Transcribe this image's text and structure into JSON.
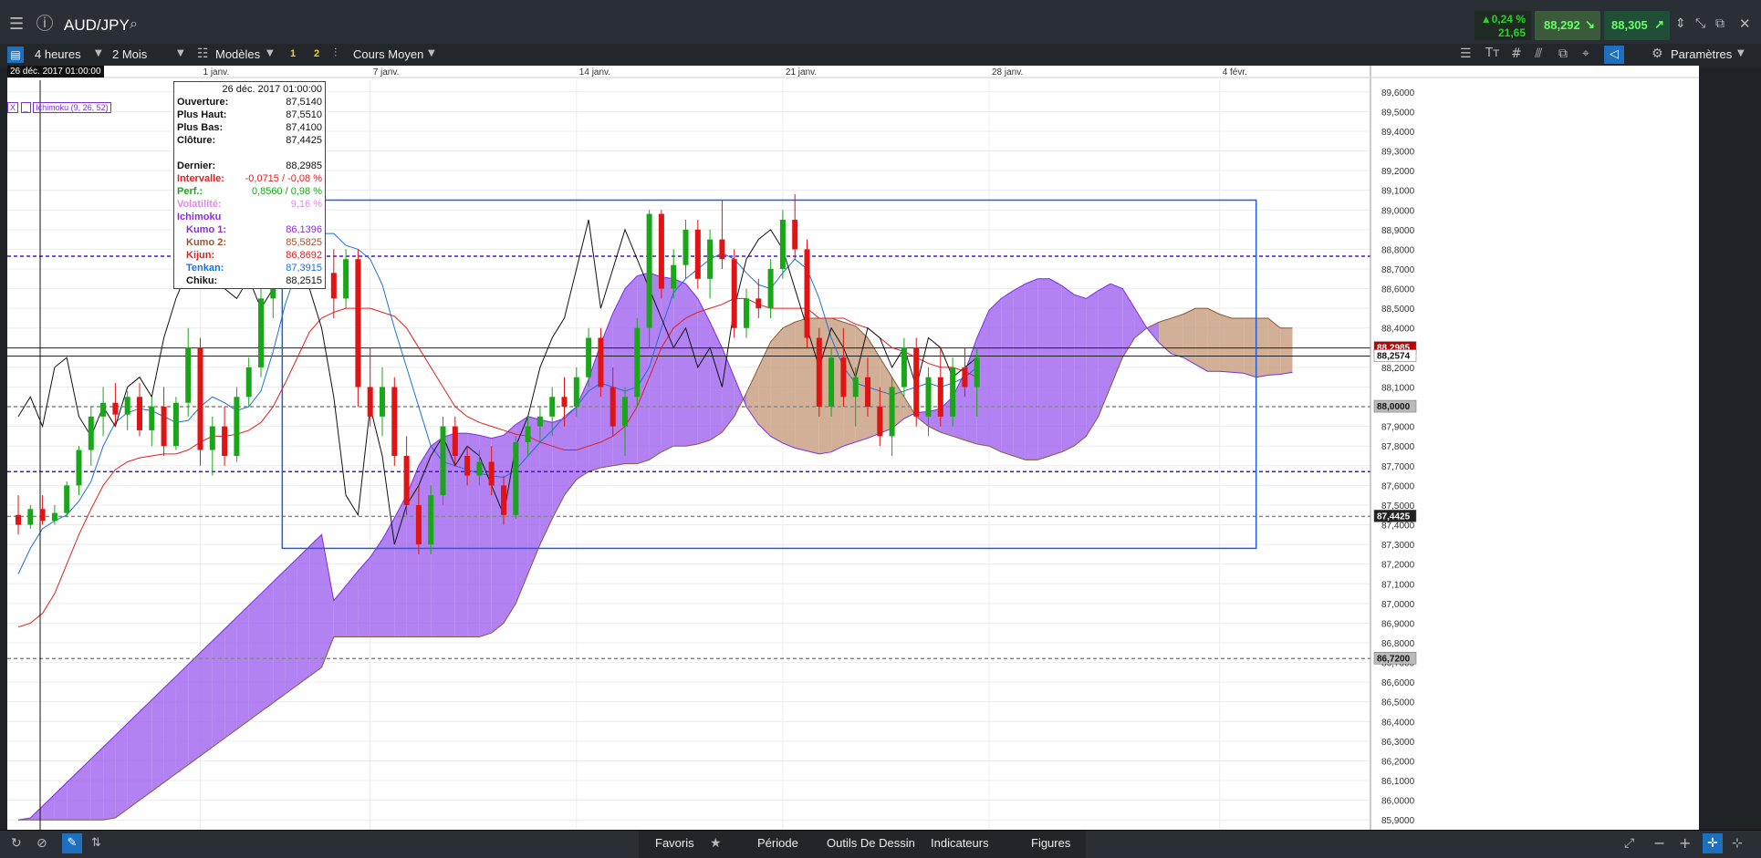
{
  "toolbar": {
    "symbol": "AUD/JPY",
    "change_pct": "▲0,24 %",
    "change_abs": "21,65",
    "bid": "88,292",
    "ask": "88,305",
    "interval": "4 heures",
    "range": "2 Mois",
    "templates": "Modèles",
    "tag1": "1",
    "tag2": "2",
    "price_type": "Cours Moyen",
    "settings": "Paramètres"
  },
  "cursor": {
    "date_label": "26 déc. 2017 01:00:00"
  },
  "indicator_tag": "Ichimoku (9, 26, 52)",
  "infobox": {
    "title": "26 déc. 2017 01:00:00",
    "rows": [
      {
        "k": "Ouverture:",
        "v": "87,5140",
        "color": "#111111"
      },
      {
        "k": "Plus Haut:",
        "v": "87,5510",
        "color": "#111111"
      },
      {
        "k": "Plus Bas:",
        "v": "87,4100",
        "color": "#111111"
      },
      {
        "k": "Clôture:",
        "v": "87,4425",
        "color": "#111111"
      },
      {
        "k": "",
        "v": "",
        "color": "#111111"
      },
      {
        "k": "Dernier:",
        "v": "88,2985",
        "color": "#111111"
      },
      {
        "k": "Intervalle:",
        "v": "-0,0715 / -0,08 %",
        "color": "#e02020"
      },
      {
        "k": "Perf.:",
        "v": "0,8560 / 0,98 %",
        "color": "#19a619"
      },
      {
        "k": "Volatilité:",
        "v": "9,16 %",
        "color": "#e08ae8"
      },
      {
        "k": "Ichimoku",
        "v": "",
        "color": "#8a2be2"
      },
      {
        "k": "  Kumo 1:",
        "v": "86,1396",
        "color": "#8a2be2"
      },
      {
        "k": "  Kumo 2:",
        "v": "85,5825",
        "color": "#a0522d"
      },
      {
        "k": "  Kijun:",
        "v": "86,8692",
        "color": "#e02020"
      },
      {
        "k": "  Tenkan:",
        "v": "87,3915",
        "color": "#1e6fd9"
      },
      {
        "k": "  Chiku:",
        "v": "88,2515",
        "color": "#111111"
      }
    ]
  },
  "bottom": {
    "favoris": "Favoris",
    "periode": "Période",
    "outils": "Outils De Dessin",
    "indicateurs": "Indicateurs",
    "figures": "Figures"
  },
  "colors": {
    "up": "#19a619",
    "down": "#e01414",
    "kumo_bull": "#a56bf0",
    "kumo_bear": "#c9a285",
    "tenkan": "#1e6fd9",
    "kijun": "#e02020",
    "chikou": "#111111"
  },
  "chart_data": {
    "type": "candlestick",
    "title": "AUD/JPY",
    "ylim": [
      85.85,
      89.65
    ],
    "y_ticks": [
      "89,6000",
      "89,5000",
      "89,4000",
      "89,3000",
      "89,2000",
      "89,1000",
      "89,0000",
      "88,9000",
      "88,8000",
      "88,7000",
      "88,6000",
      "88,5000",
      "88,4000",
      "88,3000",
      "88,2000",
      "88,1000",
      "88,0000",
      "87,9000",
      "87,8000",
      "87,7000",
      "87,6000",
      "87,5000",
      "87,4000",
      "87,3000",
      "87,2000",
      "87,1000",
      "87,0000",
      "86,9000",
      "86,8000",
      "86,7000",
      "86,6000",
      "86,5000",
      "86,4000",
      "86,3000",
      "86,2000",
      "86,1000",
      "86,0000",
      "85,9000"
    ],
    "x_ticks": [
      "1 janv.",
      "7 janv.",
      "14 janv.",
      "21 janv.",
      "28 janv.",
      "4 févr."
    ],
    "price_labels": [
      {
        "text": "88,2985",
        "value": 88.2985,
        "bg": "#c00000"
      },
      {
        "text": "88,2574",
        "value": 88.2574,
        "bg": "#ffffff"
      },
      {
        "text": "88,0000",
        "value": 88.0,
        "bg": "#bbbbbb"
      },
      {
        "text": "87,4425",
        "value": 87.4425,
        "bg": "#222222"
      },
      {
        "text": "86,7200",
        "value": 86.72,
        "bg": "#bbbbbb"
      }
    ],
    "hlines": [
      {
        "value": 88.765,
        "color": "#4b10e0",
        "dash": true
      },
      {
        "value": 87.67,
        "color": "#4b10e0",
        "dash": true
      },
      {
        "value": 88.0,
        "color": "#888888",
        "dash": true
      },
      {
        "value": 87.4425,
        "color": "#888888",
        "dash": true
      },
      {
        "value": 86.72,
        "color": "#888888",
        "dash": true
      },
      {
        "value": 88.2985,
        "color": "#222222",
        "dash": false
      },
      {
        "value": 88.2574,
        "color": "#222222",
        "dash": false
      }
    ],
    "rectangle": {
      "x0": 0.19,
      "x1": 0.863,
      "y_top": 89.05,
      "y_bottom": 87.28
    },
    "candles": [
      {
        "o": 87.45,
        "h": 87.55,
        "l": 87.35,
        "c": 87.4
      },
      {
        "o": 87.4,
        "h": 87.5,
        "l": 87.38,
        "c": 87.48
      },
      {
        "o": 87.48,
        "h": 87.55,
        "l": 87.4,
        "c": 87.42
      },
      {
        "o": 87.42,
        "h": 87.5,
        "l": 87.4,
        "c": 87.46
      },
      {
        "o": 87.46,
        "h": 87.62,
        "l": 87.44,
        "c": 87.6
      },
      {
        "o": 87.6,
        "h": 87.8,
        "l": 87.55,
        "c": 87.78
      },
      {
        "o": 87.78,
        "h": 88.0,
        "l": 87.7,
        "c": 87.95
      },
      {
        "o": 87.95,
        "h": 88.1,
        "l": 87.85,
        "c": 88.02
      },
      {
        "o": 88.02,
        "h": 88.12,
        "l": 87.9,
        "c": 87.96
      },
      {
        "o": 87.96,
        "h": 88.08,
        "l": 87.88,
        "c": 88.05
      },
      {
        "o": 88.05,
        "h": 88.12,
        "l": 87.85,
        "c": 87.88
      },
      {
        "o": 87.88,
        "h": 88.05,
        "l": 87.8,
        "c": 88.0
      },
      {
        "o": 88.0,
        "h": 88.1,
        "l": 87.75,
        "c": 87.8
      },
      {
        "o": 87.8,
        "h": 88.05,
        "l": 87.78,
        "c": 88.02
      },
      {
        "o": 88.02,
        "h": 88.4,
        "l": 87.95,
        "c": 88.3
      },
      {
        "o": 88.3,
        "h": 88.35,
        "l": 87.7,
        "c": 87.78
      },
      {
        "o": 87.78,
        "h": 87.95,
        "l": 87.65,
        "c": 87.9
      },
      {
        "o": 87.9,
        "h": 88.0,
        "l": 87.7,
        "c": 87.75
      },
      {
        "o": 87.75,
        "h": 88.1,
        "l": 87.72,
        "c": 88.05
      },
      {
        "o": 88.05,
        "h": 88.25,
        "l": 88.0,
        "c": 88.2
      },
      {
        "o": 88.2,
        "h": 88.6,
        "l": 88.15,
        "c": 88.55
      },
      {
        "o": 88.55,
        "h": 88.8,
        "l": 88.45,
        "c": 88.75
      },
      {
        "o": 88.75,
        "h": 88.95,
        "l": 88.65,
        "c": 88.9
      },
      {
        "o": 88.9,
        "h": 89.08,
        "l": 88.8,
        "c": 89.02
      },
      {
        "o": 89.02,
        "h": 89.1,
        "l": 88.85,
        "c": 88.9
      },
      {
        "o": 88.9,
        "h": 88.95,
        "l": 88.6,
        "c": 88.68
      },
      {
        "o": 88.68,
        "h": 88.8,
        "l": 88.45,
        "c": 88.55
      },
      {
        "o": 88.55,
        "h": 88.8,
        "l": 88.5,
        "c": 88.75
      },
      {
        "o": 88.75,
        "h": 88.8,
        "l": 88.0,
        "c": 88.1
      },
      {
        "o": 88.1,
        "h": 88.3,
        "l": 87.9,
        "c": 87.95
      },
      {
        "o": 87.95,
        "h": 88.2,
        "l": 87.85,
        "c": 88.1
      },
      {
        "o": 88.1,
        "h": 88.15,
        "l": 87.7,
        "c": 87.75
      },
      {
        "o": 87.75,
        "h": 87.85,
        "l": 87.45,
        "c": 87.5
      },
      {
        "o": 87.5,
        "h": 87.6,
        "l": 87.25,
        "c": 87.3
      },
      {
        "o": 87.3,
        "h": 87.6,
        "l": 87.25,
        "c": 87.55
      },
      {
        "o": 87.55,
        "h": 87.95,
        "l": 87.5,
        "c": 87.9
      },
      {
        "o": 87.9,
        "h": 87.95,
        "l": 87.7,
        "c": 87.75
      },
      {
        "o": 87.75,
        "h": 87.8,
        "l": 87.6,
        "c": 87.65
      },
      {
        "o": 87.65,
        "h": 87.78,
        "l": 87.6,
        "c": 87.72
      },
      {
        "o": 87.72,
        "h": 87.8,
        "l": 87.55,
        "c": 87.6
      },
      {
        "o": 87.6,
        "h": 87.65,
        "l": 87.4,
        "c": 87.45
      },
      {
        "o": 87.45,
        "h": 87.85,
        "l": 87.43,
        "c": 87.82
      },
      {
        "o": 87.82,
        "h": 87.95,
        "l": 87.75,
        "c": 87.9
      },
      {
        "o": 87.9,
        "h": 88.0,
        "l": 87.82,
        "c": 87.95
      },
      {
        "o": 87.95,
        "h": 88.1,
        "l": 87.85,
        "c": 88.05
      },
      {
        "o": 88.05,
        "h": 88.15,
        "l": 87.9,
        "c": 88.0
      },
      {
        "o": 88.0,
        "h": 88.2,
        "l": 87.95,
        "c": 88.15
      },
      {
        "o": 88.15,
        "h": 88.4,
        "l": 88.1,
        "c": 88.35
      },
      {
        "o": 88.35,
        "h": 88.4,
        "l": 88.05,
        "c": 88.1
      },
      {
        "o": 88.1,
        "h": 88.2,
        "l": 87.85,
        "c": 87.9
      },
      {
        "o": 87.9,
        "h": 88.1,
        "l": 87.75,
        "c": 88.05
      },
      {
        "o": 88.05,
        "h": 88.45,
        "l": 88.0,
        "c": 88.4
      },
      {
        "o": 88.4,
        "h": 89.0,
        "l": 88.3,
        "c": 88.98
      },
      {
        "o": 88.98,
        "h": 89.0,
        "l": 88.55,
        "c": 88.6
      },
      {
        "o": 88.6,
        "h": 88.8,
        "l": 88.55,
        "c": 88.72
      },
      {
        "o": 88.72,
        "h": 88.95,
        "l": 88.65,
        "c": 88.9
      },
      {
        "o": 88.9,
        "h": 88.95,
        "l": 88.6,
        "c": 88.65
      },
      {
        "o": 88.65,
        "h": 88.9,
        "l": 88.55,
        "c": 88.85
      },
      {
        "o": 88.85,
        "h": 89.05,
        "l": 88.7,
        "c": 88.75
      },
      {
        "o": 88.75,
        "h": 88.8,
        "l": 88.35,
        "c": 88.4
      },
      {
        "o": 88.4,
        "h": 88.6,
        "l": 88.35,
        "c": 88.55
      },
      {
        "o": 88.55,
        "h": 88.65,
        "l": 88.45,
        "c": 88.5
      },
      {
        "o": 88.5,
        "h": 88.75,
        "l": 88.45,
        "c": 88.7
      },
      {
        "o": 88.7,
        "h": 89.0,
        "l": 88.65,
        "c": 88.95
      },
      {
        "o": 88.95,
        "h": 89.08,
        "l": 88.75,
        "c": 88.8
      },
      {
        "o": 88.8,
        "h": 88.85,
        "l": 88.3,
        "c": 88.35
      },
      {
        "o": 88.35,
        "h": 88.4,
        "l": 87.95,
        "c": 88.0
      },
      {
        "o": 88.0,
        "h": 88.3,
        "l": 87.95,
        "c": 88.25
      },
      {
        "o": 88.25,
        "h": 88.4,
        "l": 88.0,
        "c": 88.05
      },
      {
        "o": 88.05,
        "h": 88.2,
        "l": 87.9,
        "c": 88.15
      },
      {
        "o": 88.15,
        "h": 88.25,
        "l": 87.95,
        "c": 88.0
      },
      {
        "o": 88.0,
        "h": 88.1,
        "l": 87.8,
        "c": 87.85
      },
      {
        "o": 87.85,
        "h": 88.15,
        "l": 87.75,
        "c": 88.1
      },
      {
        "o": 88.1,
        "h": 88.35,
        "l": 88.05,
        "c": 88.3
      },
      {
        "o": 88.3,
        "h": 88.35,
        "l": 87.9,
        "c": 87.95
      },
      {
        "o": 87.95,
        "h": 88.2,
        "l": 87.85,
        "c": 88.15
      },
      {
        "o": 88.15,
        "h": 88.3,
        "l": 87.9,
        "c": 87.95
      },
      {
        "o": 87.95,
        "h": 88.25,
        "l": 87.9,
        "c": 88.2
      },
      {
        "o": 88.2,
        "h": 88.3,
        "l": 88.05,
        "c": 88.1
      },
      {
        "o": 88.1,
        "h": 88.3,
        "l": 87.95,
        "c": 88.25
      }
    ],
    "series": [
      {
        "name": "Tenkan",
        "values": [
          87.15,
          87.28,
          87.38,
          87.42,
          87.45,
          87.52,
          87.62,
          87.8,
          87.92,
          87.97,
          87.99,
          87.98,
          87.95,
          87.92,
          87.93,
          88.0,
          88.05,
          88.02,
          87.98,
          88.0,
          88.08,
          88.28,
          88.52,
          88.7,
          88.82,
          88.88,
          88.88,
          88.82,
          88.8,
          88.75,
          88.62,
          88.4,
          88.2,
          88.0,
          87.8,
          87.72,
          87.7,
          87.68,
          87.66,
          87.65,
          87.64,
          87.68,
          87.75,
          87.82,
          87.88,
          87.95,
          88.0,
          88.08,
          88.12,
          88.1,
          88.08,
          88.1,
          88.2,
          88.4,
          88.58,
          88.65,
          88.7,
          88.75,
          88.78,
          88.75,
          88.68,
          88.62,
          88.6,
          88.68,
          88.75,
          88.7,
          88.55,
          88.35,
          88.2,
          88.12,
          88.1,
          88.08,
          88.06,
          88.08,
          88.1,
          88.12,
          88.1,
          88.12,
          88.15,
          88.2
        ]
      },
      {
        "name": "Kijun",
        "values": [
          86.88,
          86.9,
          86.95,
          87.05,
          87.2,
          87.35,
          87.48,
          87.6,
          87.68,
          87.72,
          87.74,
          87.75,
          87.76,
          87.76,
          87.78,
          87.82,
          87.85,
          87.85,
          87.86,
          87.88,
          87.92,
          88.0,
          88.12,
          88.25,
          88.38,
          88.45,
          88.48,
          88.5,
          88.5,
          88.5,
          88.48,
          88.46,
          88.4,
          88.3,
          88.2,
          88.1,
          88.0,
          87.95,
          87.92,
          87.9,
          87.88,
          87.86,
          87.85,
          87.82,
          87.8,
          87.78,
          87.78,
          87.8,
          87.82,
          87.85,
          87.9,
          88.0,
          88.15,
          88.3,
          88.4,
          88.45,
          88.48,
          88.5,
          88.52,
          88.55,
          88.55,
          88.52,
          88.5,
          88.5,
          88.5,
          88.5,
          88.45,
          88.45,
          88.45,
          88.42,
          88.4,
          88.35,
          88.3,
          88.28,
          88.25,
          88.22,
          88.2,
          88.2,
          88.18,
          88.15
        ]
      },
      {
        "name": "Chikou",
        "values": [
          87.95,
          88.05,
          87.9,
          88.2,
          88.25,
          87.95,
          87.85,
          88.0,
          87.9,
          88.1,
          88.15,
          88.05,
          88.35,
          88.55,
          88.7,
          88.78,
          88.7,
          88.6,
          88.55,
          88.65,
          88.5,
          88.6,
          88.7,
          88.75,
          88.6,
          88.4,
          88.05,
          87.55,
          87.45,
          88.0,
          87.75,
          87.3,
          87.5,
          87.6,
          87.75,
          87.85,
          87.7,
          87.8,
          87.75,
          87.6,
          87.45,
          87.8,
          87.95,
          88.2,
          88.35,
          88.45,
          88.7,
          88.95,
          88.5,
          88.7,
          88.9,
          88.75,
          88.6,
          88.45,
          88.3,
          88.4,
          88.2,
          88.3,
          88.1,
          88.5,
          88.75,
          88.85,
          88.9,
          88.8,
          88.6,
          88.4,
          88.2,
          88.4,
          88.3,
          88.15,
          88.4,
          88.35,
          88.2,
          88.3,
          88.1,
          88.35,
          88.3,
          88.15,
          88.2,
          88.25
        ]
      }
    ]
  }
}
